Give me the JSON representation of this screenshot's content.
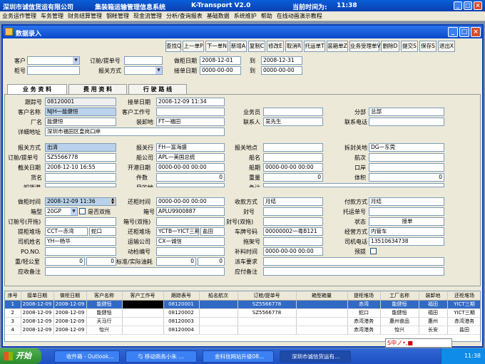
{
  "app": {
    "company": "深圳市诚信货运有限公司",
    "system": "集装箱运输管理信息系统",
    "version": "K-Transport V2.0",
    "time_label": "当前时间为:",
    "time": "11:38"
  },
  "menu": [
    "业务运作管理",
    "车务管理",
    "财务结算管理",
    "钢帐管理",
    "现金流管理",
    "分析/查询报表",
    "基础数据",
    "系统维护",
    "帮助",
    "在线动画演示教程"
  ],
  "window": {
    "title": "数据录入"
  },
  "toolbar": [
    "查找Q",
    "上一单P",
    "下一单N",
    "新增A",
    "复制C",
    "修改E",
    "取消R",
    "托运单T",
    "装箱单Z",
    "业务受理单V",
    "删除D",
    "提交S",
    "保存S",
    "退出X"
  ],
  "filter": {
    "customer_label": "客户",
    "order_label": "订舱/提单号",
    "bill_label": "柜号",
    "declare_label": "报关方式",
    "date1_label": "做柜日期",
    "date1_from": "2008-12-01",
    "date1_to": "2008-12-31",
    "to_label": "到",
    "date2_label": "接单日期",
    "date2_from": "0000-00-00",
    "date2_to": "0000-00-00"
  },
  "tabs": [
    "业 务 资 料",
    "费 用 资 料",
    "行 驶 路 线"
  ],
  "form": {
    "track_no_l": "跟踪号",
    "track_no": "08120001",
    "receive_date_l": "接单日期",
    "receive_date": "2008-12-09 11:34",
    "cust_name_l": "客户名称",
    "cust_name": "NJH一能健恒",
    "cust_job_l": "客户工作号",
    "salesman_l": "业务员",
    "branch_l": "分部",
    "branch": "总部",
    "factory_l": "厂名",
    "factory": "能健恒",
    "load_l": "装卸地",
    "load": "FT一福田",
    "contact_l": "联系人",
    "contact": "吴先生",
    "contact_tel_l": "联系电话",
    "address_l": "详细地址",
    "address": "深圳市福田区皇岗口岸",
    "declare_l": "报关方式",
    "declare": "出清",
    "declare_co_l": "报关行",
    "declare_co": "FH一富海盛",
    "declare_place_l": "报关地点",
    "customs_l": "拆封关地",
    "customs": "DG一东莞",
    "order_l": "订舱/提单号",
    "order": "SZ5566778",
    "ship_co_l": "船公司",
    "ship_co": "APL一美国总统",
    "ship_name_l": "船名",
    "voyage_l": "航次",
    "cutoff_l": "截关日期",
    "cutoff": "2008-12-10 16:55",
    "open_l": "开港日期",
    "open": "0000-00-00 00:00",
    "sail_l": "船期",
    "sail": "0000-00-00 00:00",
    "port_l": "口岸",
    "goods_l": "货名",
    "pieces_l": "件数",
    "pieces": "0",
    "weight_l": "重量",
    "weight": "0",
    "volume_l": "体积",
    "volume": "0",
    "unload_l": "卸货港",
    "dest_l": "目的地",
    "remark_l": "备注",
    "work_date_l": "做柜时间",
    "work_date": "2008-12-09 11:36",
    "return_date_l": "还柜时间",
    "return_date": "0000-00-00 00:00",
    "collect_l": "收款方式",
    "collect": "月结",
    "pay_l": "付款方式",
    "pay": "月结",
    "ctype_l": "箱型",
    "ctype": "20GP",
    "double_l": "是否双拖",
    "cno_l": "箱号",
    "cno": "APLU9900887",
    "seal_l": "封号",
    "ship_order_l": "托运单号",
    "order2_l": "订舱号(开拖)",
    "cno2_l": "箱号(双拖)",
    "seal2_l": "封号(双拖)",
    "status_l": "状态",
    "status": "接单",
    "yard_l": "提柜堆场",
    "yard": "CCT一赤湾",
    "yard2": "蛇口",
    "ryard_l": "还柜堆场",
    "ryard": "YCTB一YICT三期",
    "ryard2": "盐田",
    "plate_l": "车牌号码",
    "plate": "00000002一粤B121",
    "manager_l": "经营方式",
    "manager": "内管车",
    "driver_l": "司机姓名",
    "driver": "YH一杨华",
    "carrier_l": "运输公司",
    "carrier": "CX一诚信",
    "trailer_l": "拖架号",
    "driver_tel_l": "司机电话",
    "driver_tel": "13510634738",
    "po_l": "PO.NO.",
    "plug_l": "动检编号",
    "cargo_time_l": "补料时间",
    "cargo_time": "0000-00-00 00:00",
    "precharge_l": "预提",
    "fuel_l": "重/轻公里",
    "fuel1": "0",
    "fuel2": "0",
    "oil_l": "标准/实际油耗",
    "oil1": "0",
    "oil2": "0",
    "dispatch_l": "派车要求",
    "receivable_l": "应收备注",
    "payable_l": "应付备注"
  },
  "grid": {
    "headers": [
      "序号",
      "接单日期",
      "做柜日期",
      "客户名称",
      "客户工作号",
      "跟踪表号",
      "船名航次",
      "订舱/提单号",
      "箱型箱量",
      "提柜堆场",
      "工厂名称",
      "装卸地",
      "还柜堆场"
    ],
    "rows": [
      [
        "1",
        "2008-12-09",
        "2008-12-09",
        "能健恒",
        "",
        "08120001",
        "",
        "SZ5566778",
        "",
        "赤湾",
        "能健恒",
        "福田",
        "YICT三期"
      ],
      [
        "2",
        "2008-12-09",
        "2008-12-09",
        "能健恒",
        "",
        "08120002",
        "",
        "SZ5566778",
        "",
        "蛇口",
        "能健恒",
        "福田",
        "YICT三期"
      ],
      [
        "3",
        "2008-12-09",
        "2008-12-09",
        "天马行",
        "",
        "08120003",
        "",
        "",
        "",
        "赤湾港务",
        "惠州食品",
        "惠州",
        "赤湾港务"
      ],
      [
        "4",
        "2008-12-09",
        "2008-12-09",
        "怡兴",
        "",
        "08120004",
        "",
        "",
        "",
        "赤湾港务",
        "怡兴",
        "长安",
        "盐田"
      ]
    ]
  },
  "taskbar": {
    "start": "开始",
    "tasks": [
      "收件箱 - Outlook…",
      "与 移动商务小朱 …",
      "金科信网站升级08…",
      "深圳市诚信货运有…"
    ],
    "clock": "11:38"
  },
  "ime": "S中ノ•,■"
}
